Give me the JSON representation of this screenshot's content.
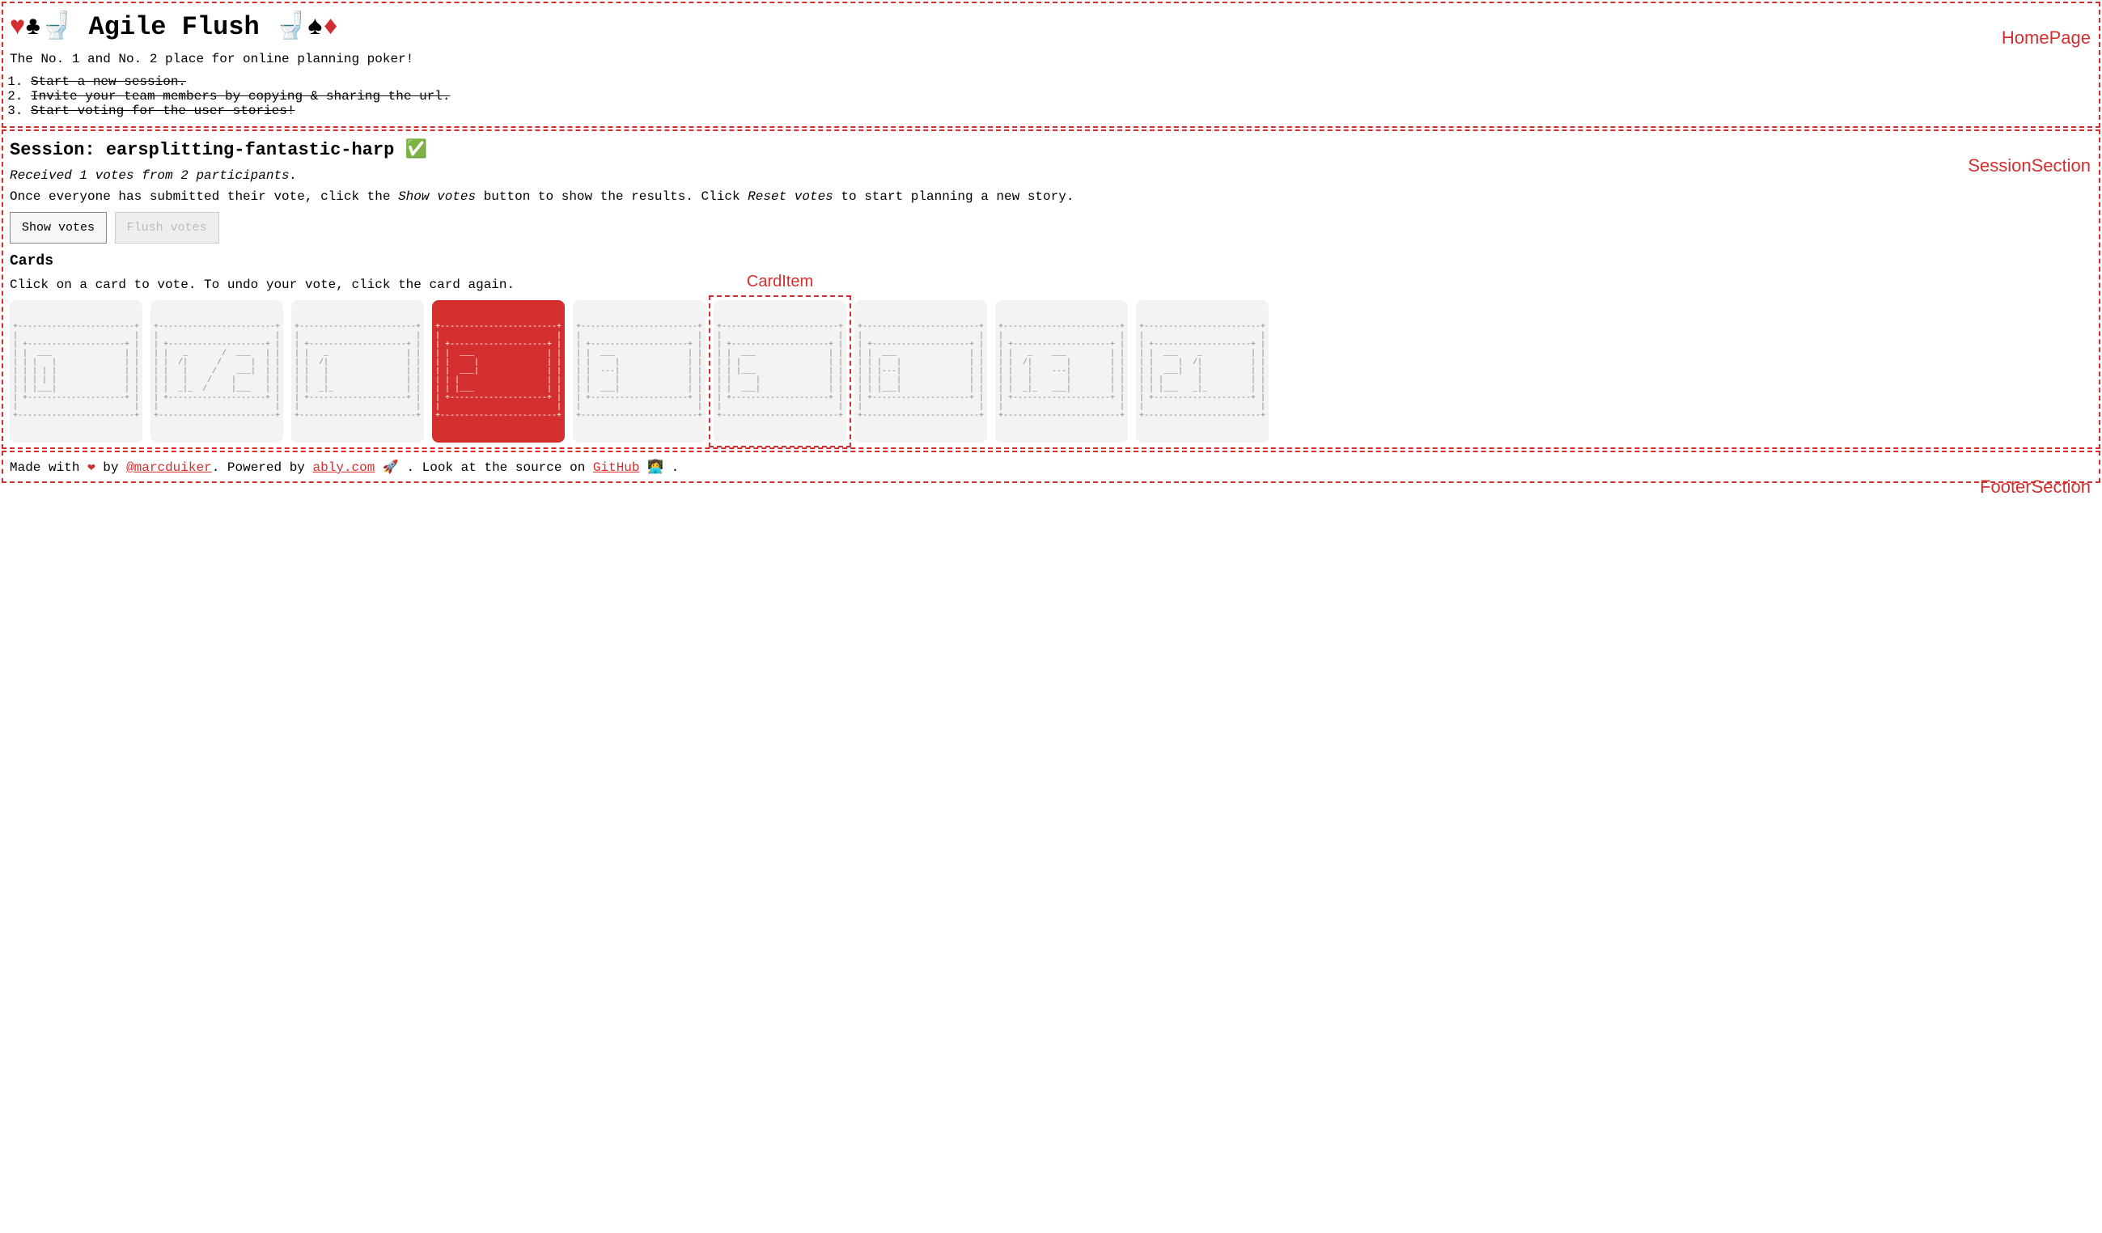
{
  "header": {
    "title_prefix": "♥♣🚽 ",
    "title_text": "Agile Flush",
    "title_suffix": " 🚽♠♦",
    "tagline": "The No. 1 and No. 2 place for online planning poker!",
    "steps": [
      "Start a new session.",
      "Invite your team members by copying & sharing the url.",
      "Start voting for the user stories!"
    ],
    "section_label": "HomePage"
  },
  "session": {
    "prefix": "Session: ",
    "name": "earsplitting-fantastic-harp",
    "check": " ✅",
    "status": "Received 1 votes from 2 participants.",
    "instructions_pre": "Once everyone has submitted their vote, click the ",
    "instructions_em1": "Show votes",
    "instructions_mid": " button to show the results. Click ",
    "instructions_em2": "Reset votes",
    "instructions_post": " to start planning a new story.",
    "show_votes_label": "Show votes",
    "flush_votes_label": "Flush votes",
    "cards_heading": "Cards",
    "cards_hint": "Click on a card to vote. To undo your vote, click the card again.",
    "section_label": "SessionSection",
    "carditem_label": "CardItem",
    "cards": [
      {
        "value": "0",
        "selected": false,
        "highlight": false
      },
      {
        "value": "1/2",
        "selected": false,
        "highlight": false
      },
      {
        "value": "1",
        "selected": false,
        "highlight": false
      },
      {
        "value": "2",
        "selected": true,
        "highlight": false
      },
      {
        "value": "3",
        "selected": false,
        "highlight": false
      },
      {
        "value": "5",
        "selected": false,
        "highlight": true
      },
      {
        "value": "8",
        "selected": false,
        "highlight": false
      },
      {
        "value": "13",
        "selected": false,
        "highlight": false
      },
      {
        "value": "21",
        "selected": false,
        "highlight": false
      }
    ]
  },
  "footer": {
    "made_with": "Made with ",
    "heart": "❤",
    "by": " by ",
    "author": "@marcduiker",
    "period1": ". Powered by ",
    "ably": "ably.com",
    "rocket": " 🚀 . Look at the source on ",
    "github": "GitHub",
    "dev": " 👩‍💻 .",
    "section_label": "FooterSection"
  }
}
